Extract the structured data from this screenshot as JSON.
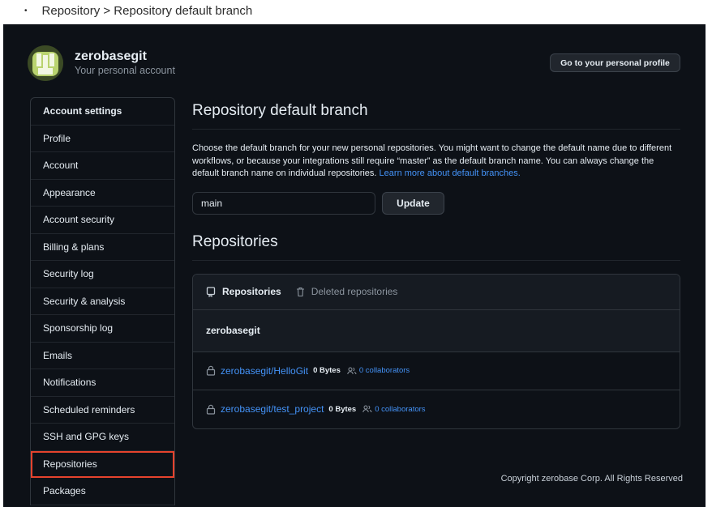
{
  "caption": {
    "bullet": "•",
    "text": "Repository > Repository default branch"
  },
  "account": {
    "name": "zerobasegit",
    "subtitle": "Your personal account",
    "profile_button": "Go to your personal profile"
  },
  "sidebar": {
    "heading": "Account settings",
    "items": [
      {
        "label": "Profile"
      },
      {
        "label": "Account"
      },
      {
        "label": "Appearance"
      },
      {
        "label": "Account security"
      },
      {
        "label": "Billing & plans"
      },
      {
        "label": "Security log"
      },
      {
        "label": "Security & analysis"
      },
      {
        "label": "Sponsorship log"
      },
      {
        "label": "Emails"
      },
      {
        "label": "Notifications"
      },
      {
        "label": "Scheduled reminders"
      },
      {
        "label": "SSH and GPG keys"
      },
      {
        "label": "Repositories",
        "selected": true
      },
      {
        "label": "Packages"
      }
    ],
    "highlight_color": "#e5432d"
  },
  "default_branch": {
    "title": "Repository default branch",
    "description": "Choose the default branch for your new personal repositories. You might want to change the default name due to different workflows, or because your integrations still require “master” as the default branch name. You can always change the default branch name on individual repositories.",
    "learn_more": "Learn more about default branches.",
    "input_value": "main",
    "update_button": "Update"
  },
  "repositories": {
    "title": "Repositories",
    "tabs": [
      {
        "label": "Repositories",
        "icon": "repo-icon",
        "active": true
      },
      {
        "label": "Deleted repositories",
        "icon": "trash-icon",
        "active": false
      }
    ],
    "owner": "zerobasegit",
    "rows": [
      {
        "name": "zerobasegit/HelloGit",
        "size": "0 Bytes",
        "collaborators": "0 collaborators",
        "icon": "lock-icon"
      },
      {
        "name": "zerobasegit/test_project",
        "size": "0 Bytes",
        "collaborators": "0 collaborators",
        "icon": "lock-icon"
      }
    ]
  },
  "footer": {
    "copyright": "Copyright zerobase Corp. All Rights Reserved"
  },
  "colors": {
    "background": "#0d1117",
    "link": "#4493f8",
    "border": "#30363d"
  }
}
